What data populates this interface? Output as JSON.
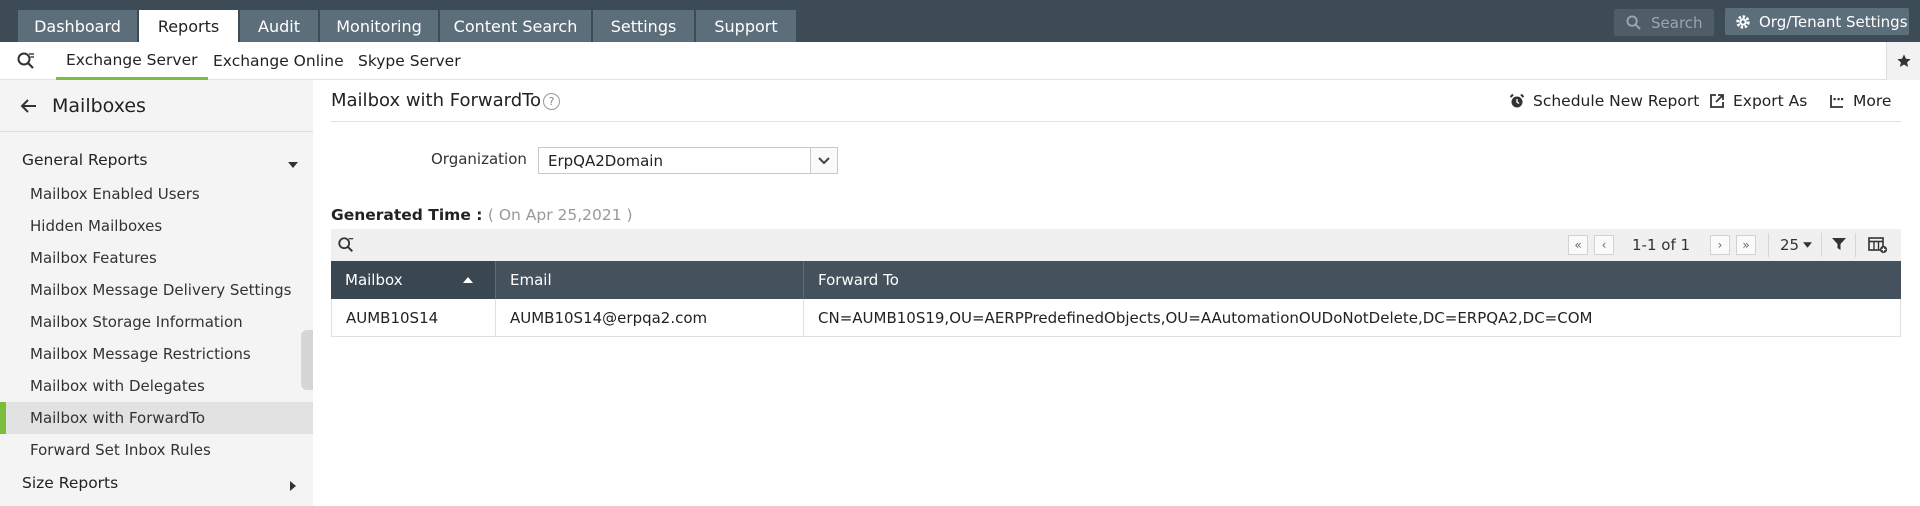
{
  "topnav": {
    "tabs": [
      {
        "label": "Dashboard",
        "active": false
      },
      {
        "label": "Reports",
        "active": true
      },
      {
        "label": "Audit",
        "active": false
      },
      {
        "label": "Monitoring",
        "active": false
      },
      {
        "label": "Content Search",
        "active": false
      },
      {
        "label": "Settings",
        "active": false
      },
      {
        "label": "Support",
        "active": false
      }
    ],
    "search_placeholder": "Search",
    "org_settings_label": "Org/Tenant Settings"
  },
  "subnav": {
    "items": [
      {
        "label": "Exchange Server",
        "active": true
      },
      {
        "label": "Exchange Online",
        "active": false
      },
      {
        "label": "Skype Server",
        "active": false
      }
    ]
  },
  "sidebar": {
    "title": "Mailboxes",
    "groups": [
      {
        "label": "General Reports",
        "expanded": true
      },
      {
        "label": "Size Reports",
        "expanded": false
      }
    ],
    "items": [
      {
        "label": "Mailbox Enabled Users",
        "active": false
      },
      {
        "label": "Hidden Mailboxes",
        "active": false
      },
      {
        "label": "Mailbox Features",
        "active": false
      },
      {
        "label": "Mailbox Message Delivery Settings",
        "active": false
      },
      {
        "label": "Mailbox Storage Information",
        "active": false
      },
      {
        "label": "Mailbox Message Restrictions",
        "active": false
      },
      {
        "label": "Mailbox with Delegates",
        "active": false
      },
      {
        "label": "Mailbox with ForwardTo",
        "active": true
      },
      {
        "label": "Forward Set Inbox Rules",
        "active": false
      }
    ]
  },
  "main": {
    "title": "Mailbox with ForwardTo",
    "actions": {
      "schedule": "Schedule New Report",
      "export": "Export As",
      "more": "More"
    },
    "organization_label": "Organization",
    "organization_value": "ErpQA2Domain",
    "generated_time_label": "Generated Time :",
    "generated_time_value": "( On Apr 25,2021 )",
    "pagination": {
      "range": "1-1 of 1",
      "page_size": "25"
    },
    "table": {
      "columns": [
        "Mailbox",
        "Email",
        "Forward To"
      ],
      "sorted_column": "Mailbox",
      "sort_direction": "ascending",
      "rows": [
        [
          "AUMB10S14",
          "AUMB10S14@erpqa2.com",
          "CN=AUMB10S19,OU=AERPPredefinedObjects,OU=AAutomationOUDoNotDelete,DC=ERPQA2,DC=COM"
        ]
      ]
    }
  },
  "colors": {
    "topbar": "#3d4b56",
    "accent_green": "#7cbd3e",
    "table_header": "#45525d"
  }
}
